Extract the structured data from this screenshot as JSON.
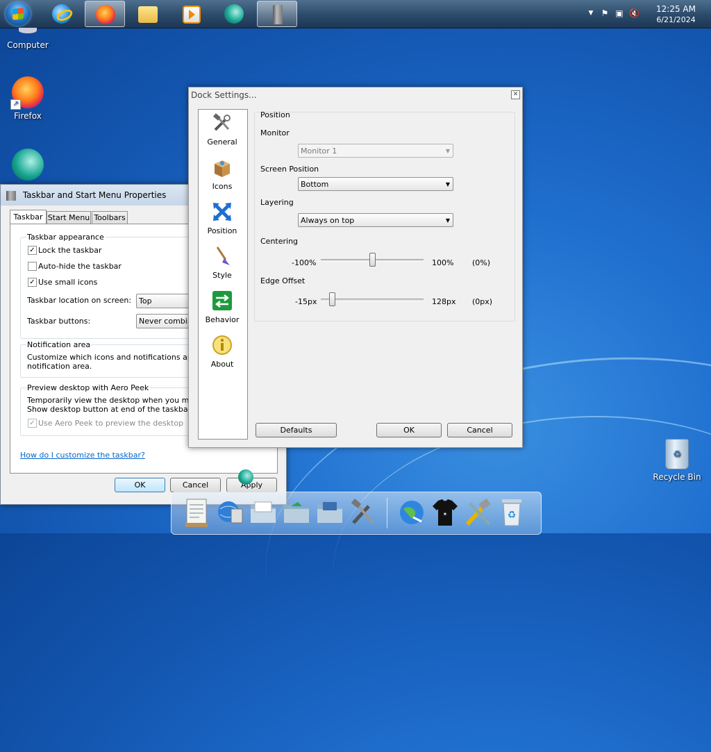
{
  "taskbar": {
    "clock_time": "12:25 AM",
    "clock_date": "6/21/2024",
    "buttons": [
      "start-orb",
      "internet-explorer-icon",
      "firefox-icon",
      "file-explorer-icon",
      "media-player-icon",
      "app-teal-icon",
      "dock-settings-icon"
    ]
  },
  "desktop": {
    "computer_label": "Computer",
    "firefox_label": "Firefox",
    "recycle_label": "Recycle Bin"
  },
  "taskbar_props": {
    "title": "Taskbar and Start Menu Properties",
    "tabs": [
      "Taskbar",
      "Start Menu",
      "Toolbars"
    ],
    "appearance": {
      "heading": "Taskbar appearance",
      "lock_label": "Lock the taskbar",
      "lock_checked": true,
      "autohide_label": "Auto-hide the taskbar",
      "autohide_checked": false,
      "small_icons_label": "Use small icons",
      "small_icons_checked": true,
      "location_label": "Taskbar location on screen:",
      "location_value": "Top",
      "buttons_label": "Taskbar buttons:",
      "buttons_value": "Never combine"
    },
    "notification": {
      "heading": "Notification area",
      "text1": "Customize which icons and notifications appear i",
      "text2": "notification area."
    },
    "peek": {
      "heading": "Preview desktop with Aero Peek",
      "text1": "Temporarily view the desktop when you move yo",
      "text2": "Show desktop button at end of the taskbar.",
      "checkbox_label": "Use Aero Peek to preview the desktop",
      "checkbox_checked": true
    },
    "help_link": "How do I customize the taskbar?",
    "ok_label": "OK",
    "cancel_label": "Cancel",
    "apply_label": "Apply"
  },
  "dock_settings": {
    "title": "Dock Settings...",
    "sidebar": [
      "General",
      "Icons",
      "Position",
      "Style",
      "Behavior",
      "About"
    ],
    "position_heading": "Position",
    "monitor_label": "Monitor",
    "monitor_value": "Monitor 1",
    "screen_position_label": "Screen Position",
    "screen_position_value": "Bottom",
    "layering_label": "Layering",
    "layering_value": "Always on top",
    "centering": {
      "label": "Centering",
      "min_label": "-100%",
      "max_label": "100%",
      "current_label": "(0%)",
      "min": -100,
      "max": 100,
      "value": 0
    },
    "edge_offset": {
      "label": "Edge Offset",
      "min_label": "-15px",
      "max_label": "128px",
      "current_label": "(0px)",
      "min": -15,
      "max": 128,
      "value": 0
    },
    "defaults_label": "Defaults",
    "ok_label": "OK",
    "cancel_label": "Cancel"
  },
  "dock": {
    "items": [
      "notepad-icon",
      "network-icon",
      "folder-icon",
      "folder-green-icon",
      "folder-blue-icon",
      "tools-icon",
      "globe-icon",
      "tshirt-icon",
      "settings-tools-icon",
      "recycle-icon"
    ]
  },
  "colors": {
    "accent": "#3c7fb1",
    "link": "#0066cc"
  }
}
